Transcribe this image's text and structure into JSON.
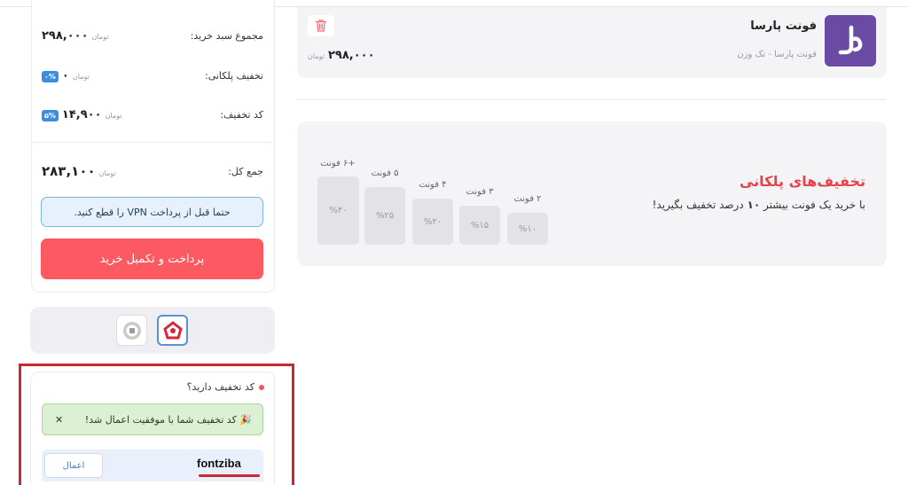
{
  "summary": {
    "subtotal_label": "مجموع سبد خرید:",
    "subtotal_value": "۲۹۸,۰۰۰",
    "tier_discount_label": "تخفیف پلکانی:",
    "tier_discount_value": "۰",
    "tier_discount_badge": "۰%",
    "coupon_label": "کد تخفیف:",
    "coupon_value": "۱۴,۹۰۰",
    "coupon_badge": "۵%",
    "total_label": "جمع کل:",
    "total_value": "۲۸۳,۱۰۰",
    "currency": "تومان",
    "vpn_note": "حتما قبل از پرداخت VPN را قطع کنید.",
    "checkout_button": "پرداخت و تکمیل خرید"
  },
  "gateways": [
    {
      "name": "bank-mellat",
      "icon": "mellat-logo-icon",
      "selected": true
    },
    {
      "name": "zarinpal",
      "icon": "zarinpal-logo-icon",
      "selected": false
    }
  ],
  "coupon": {
    "title": "کد تخفیف دارید؟",
    "success_message": "🎉 کد تخفیف شما با موفقیت اعمال شد!",
    "close_symbol": "✕",
    "input_value": "fontziba",
    "apply_button": "اعمال"
  },
  "cart_item": {
    "name": "فونت پارسا",
    "subtitle": "فونت پارسا - تک وزن",
    "price": "۲۹۸,۰۰۰",
    "currency": "تومان"
  },
  "tiers": {
    "title": "تخفیف‌های پلکانی",
    "subtitle_pre": "با خرید یک فونت بیشتر",
    "subtitle_num": "۱۰",
    "subtitle_post": "درصد تخفیف بگیرید!",
    "items": [
      {
        "label": "۲ فونت",
        "pct": "%۱۰"
      },
      {
        "label": "۳ فونت",
        "pct": "%۱۵"
      },
      {
        "label": "۴ فونت",
        "pct": "%۲۰"
      },
      {
        "label": "۵ فونت",
        "pct": "%۲۵"
      },
      {
        "label": "+۶ فونت",
        "pct": "%۳۰"
      }
    ]
  },
  "colors": {
    "accent_red": "#fb5a62",
    "title_red": "#e9414a",
    "badge_blue": "#3b8de0",
    "logo_purple": "#6a4aa5",
    "highlight_red": "#c9282d"
  }
}
